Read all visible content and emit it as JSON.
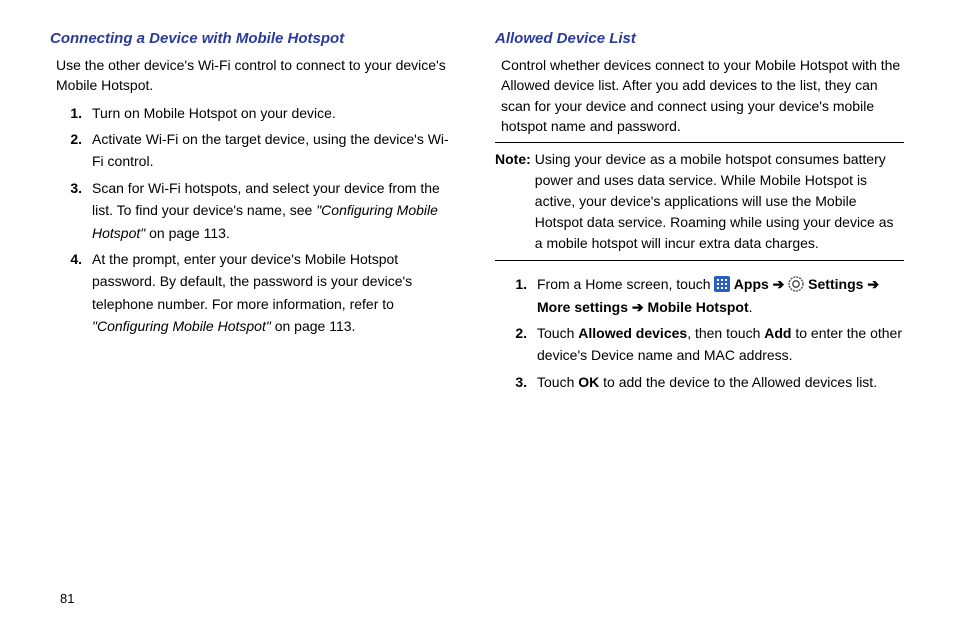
{
  "page_number": "81",
  "left": {
    "title": "Connecting a Device with Mobile Hotspot",
    "intro": "Use the other device's Wi-Fi control to connect to your device's Mobile Hotspot.",
    "steps": {
      "s1": "Turn on Mobile Hotspot on your device.",
      "s2": "Activate Wi-Fi on the target device, using the device's Wi-Fi control.",
      "s3a": "Scan for Wi-Fi hotspots, and select your device from the list. To find your device's name, see ",
      "s3b": "\"Configuring Mobile Hotspot\"",
      "s3c": " on page 113.",
      "s4a": "At the prompt, enter your device's Mobile Hotspot password. By default, the password is your device's telephone number. For more information, refer to ",
      "s4b": "\"Configuring Mobile Hotspot\"",
      "s4c": " on page 113."
    }
  },
  "right": {
    "title": "Allowed Device List",
    "intro": "Control whether devices connect to your Mobile Hotspot with the Allowed device list. After you add devices to the list, they can scan for your device and connect using your device's mobile hotspot name and password.",
    "note_label": "Note:",
    "note_text": "Using your device as a mobile hotspot consumes battery power and uses data service. While Mobile Hotspot is active, your device's applications will use the Mobile Hotspot data service. Roaming while using your device as a mobile hotspot will incur extra data charges.",
    "steps": {
      "s1a": "From a Home screen, touch ",
      "s1_apps": " Apps ",
      "s1_arrow1": "➔ ",
      "s1_settings": " Settings ",
      "s1_arrow2": "➔ ",
      "s1_more": "More settings ",
      "s1_arrow3": "➔ ",
      "s1_mh": "Mobile Hotspot",
      "s1_end": ".",
      "s2a": "Touch ",
      "s2b": "Allowed devices",
      "s2c": ", then touch ",
      "s2d": "Add",
      "s2e": " to enter the other device's Device name and MAC address.",
      "s3a": "Touch ",
      "s3b": "OK",
      "s3c": " to add the device to the Allowed devices list."
    }
  }
}
